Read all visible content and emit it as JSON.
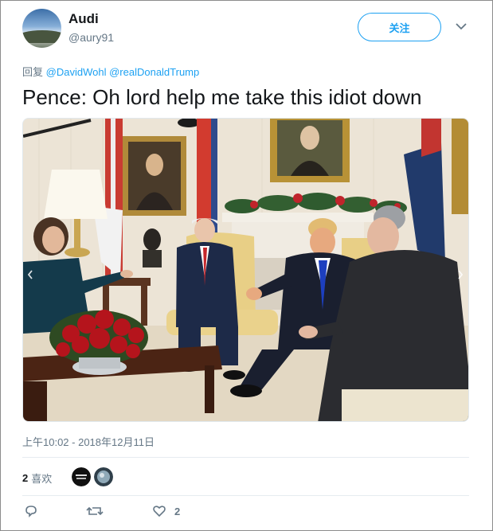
{
  "tweet": {
    "display_name": "Audi",
    "handle": "@aury91",
    "follow_label": "关注",
    "reply_prefix": "回复",
    "mentions": [
      "@DavidWohl",
      "@realDonaldTrump"
    ],
    "text": "Pence: Oh lord help me take this idiot down",
    "timestamp": "上午10:02 - 2018年12月11日",
    "likes_count": "2",
    "likes_label": "喜欢",
    "like_action_count": "2"
  },
  "icons": {
    "more": "chevron-down-icon",
    "prev": "chevron-left-icon",
    "next": "chevron-right-icon",
    "reply": "reply-icon",
    "retweet": "retweet-icon",
    "like": "heart-icon"
  },
  "colors": {
    "accent": "#1da1f2",
    "secondary_text": "#657786",
    "primary_text": "#14171a",
    "divider": "#e6ecf0"
  }
}
